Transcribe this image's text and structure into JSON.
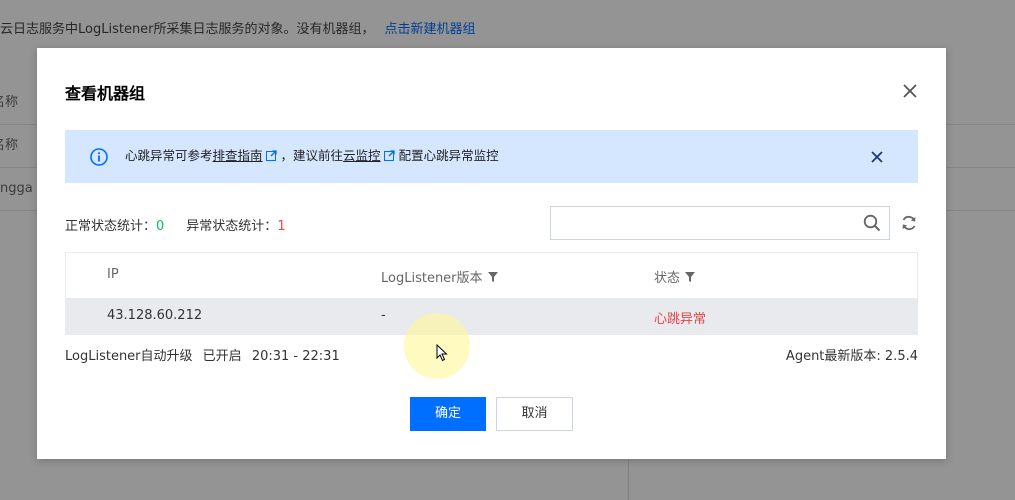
{
  "background": {
    "notice_text": "云日志服务中LogListener所采集日志服务的对象。没有机器组，",
    "notice_link": "点击新建机器组",
    "rows": [
      "名称",
      "名称",
      "angga"
    ]
  },
  "modal": {
    "title": "查看机器组",
    "notice": {
      "prefix": "心跳异常可参考",
      "link1": "排查指南",
      "middle": "，建议前往",
      "link2": "云监控",
      "suffix": "配置心跳异常监控"
    },
    "stats": {
      "normal_label": "正常状态统计：",
      "normal_count": "0",
      "abnormal_label": "异常状态统计：",
      "abnormal_count": "1"
    },
    "search": {
      "placeholder": "",
      "value": ""
    },
    "table": {
      "headers": {
        "ip": "IP",
        "version": "LogListener版本",
        "status": "状态"
      },
      "rows": [
        {
          "ip": "43.128.60.212",
          "version": "-",
          "status": "心跳异常"
        }
      ]
    },
    "upgrade": {
      "label": "LogListener自动升级",
      "state": "已开启",
      "window": "20:31 - 22:31"
    },
    "agent_version": "Agent最新版本: 2.5.4",
    "buttons": {
      "confirm": "确定",
      "cancel": "取消"
    }
  },
  "colors": {
    "primary": "#006eff",
    "notice_bg": "#d5e7ff",
    "ok": "#0abf5b",
    "error": "#e54545"
  },
  "icons": [
    "close-icon",
    "info-icon",
    "external-link-icon",
    "search-icon",
    "refresh-icon",
    "filter-icon",
    "mouse-cursor-icon"
  ]
}
